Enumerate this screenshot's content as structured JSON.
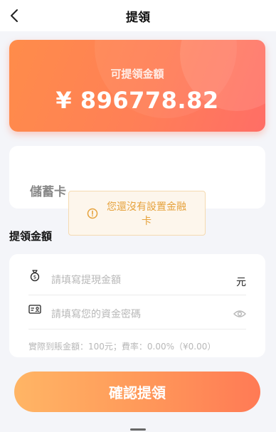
{
  "header": {
    "title": "提領",
    "back_icon": "chevron-left-icon"
  },
  "balance": {
    "label": "可提領金額",
    "amount": "¥ 896778.82"
  },
  "bank_card": {
    "label": "儲蓄卡"
  },
  "toast": {
    "icon": "warning-circle-icon",
    "message": "您還沒有設置金融卡"
  },
  "withdraw": {
    "section_title": "提領金額",
    "amount_placeholder": "請填寫提現金額",
    "amount_unit": "元",
    "amount_icon": "money-bag-icon",
    "password_placeholder": "請填寫您的資金密碼",
    "password_icon": "id-card-icon",
    "password_toggle_icon": "eye-icon",
    "note": "實際到賬金額：100元；費率：0.00%（¥0.00）"
  },
  "actions": {
    "confirm_label": "確認提領"
  },
  "colors": {
    "accent_start": "#ff8c4a",
    "accent_end": "#ff6e66",
    "button_start": "#ffb565",
    "button_end": "#ff7a55",
    "toast_text": "#e6a23c"
  }
}
